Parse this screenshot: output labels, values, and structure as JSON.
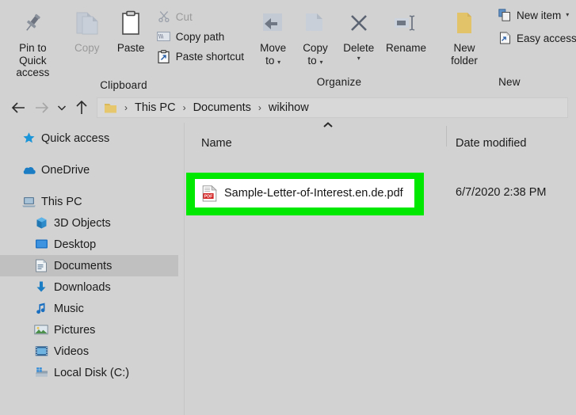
{
  "ribbon": {
    "groups": [
      {
        "name": "Clipboard",
        "label": "Clipboard",
        "big_buttons": [
          {
            "label_line1": "Pin to Quick",
            "label_line2": "access",
            "icon": "pushpin-icon",
            "enabled": true
          },
          {
            "label_line1": "Copy",
            "label_line2": "",
            "icon": "copy-icon",
            "enabled": false
          },
          {
            "label_line1": "Paste",
            "label_line2": "",
            "icon": "clipboard-icon",
            "enabled": true
          }
        ],
        "small_buttons": [
          {
            "label": "Cut",
            "icon": "scissors-icon",
            "enabled": false
          },
          {
            "label": "Copy path",
            "icon": "copy-path-icon",
            "enabled": true
          },
          {
            "label": "Paste shortcut",
            "icon": "paste-shortcut-icon",
            "enabled": true
          }
        ]
      },
      {
        "name": "Organize",
        "label": "Organize",
        "big_buttons": [
          {
            "label_line1": "Move",
            "label_line2": "to",
            "icon": "move-to-icon",
            "enabled": true,
            "has_caret": true
          },
          {
            "label_line1": "Copy",
            "label_line2": "to",
            "icon": "copy-to-icon",
            "enabled": true,
            "has_caret": true
          },
          {
            "label_line1": "Delete",
            "label_line2": "",
            "icon": "delete-x-icon",
            "enabled": true,
            "caret_below": true
          },
          {
            "label_line1": "Rename",
            "label_line2": "",
            "icon": "rename-icon",
            "enabled": true
          }
        ]
      },
      {
        "name": "New",
        "label": "New",
        "big_buttons": [
          {
            "label_line1": "New",
            "label_line2": "folder",
            "icon": "new-folder-icon",
            "enabled": true
          }
        ],
        "small_buttons": [
          {
            "label": "New item",
            "icon": "new-item-icon",
            "enabled": true,
            "has_caret": true
          },
          {
            "label": "Easy access",
            "icon": "easy-access-icon",
            "enabled": true,
            "has_caret": true
          }
        ]
      }
    ]
  },
  "addressbar": {
    "back_icon": "back-arrow-icon",
    "forward_icon": "forward-arrow-icon",
    "recent_icon": "chevron-down-icon",
    "up_icon": "up-arrow-icon",
    "folder_icon": "folder-icon",
    "breadcrumbs": [
      "This PC",
      "Documents",
      "wikihow"
    ],
    "separator": "›"
  },
  "sidebar": {
    "items": [
      {
        "label": "Quick access",
        "icon": "star-pin-icon",
        "indent": 1,
        "selected": false
      },
      {
        "label": "OneDrive",
        "icon": "onedrive-cloud-icon",
        "indent": 1,
        "selected": false
      },
      {
        "label": "This PC",
        "icon": "this-pc-icon",
        "indent": 1,
        "selected": false
      },
      {
        "label": "3D Objects",
        "icon": "3d-objects-icon",
        "indent": 2,
        "selected": false
      },
      {
        "label": "Desktop",
        "icon": "desktop-icon",
        "indent": 2,
        "selected": false
      },
      {
        "label": "Documents",
        "icon": "documents-icon",
        "indent": 2,
        "selected": true
      },
      {
        "label": "Downloads",
        "icon": "downloads-icon",
        "indent": 2,
        "selected": false
      },
      {
        "label": "Music",
        "icon": "music-icon",
        "indent": 2,
        "selected": false
      },
      {
        "label": "Pictures",
        "icon": "pictures-icon",
        "indent": 2,
        "selected": false
      },
      {
        "label": "Videos",
        "icon": "videos-icon",
        "indent": 2,
        "selected": false
      },
      {
        "label": "Local Disk (C:)",
        "icon": "local-disk-icon",
        "indent": 2,
        "selected": false
      }
    ]
  },
  "filelist": {
    "columns": {
      "name": "Name",
      "date_modified": "Date modified"
    },
    "sort_indicator": "ascending",
    "rows": [
      {
        "name": "Sample-Letter-of-Interest.en.de.pdf",
        "date_modified": "6/7/2020 2:38 PM",
        "icon": "pdf-file-icon",
        "selected": true,
        "highlighted": true
      }
    ]
  },
  "colors": {
    "highlight_green": "#00e800",
    "window_background": "#d2d2d2",
    "selected_row_background": "#c0c0c0",
    "file_row_background": "#ffffff",
    "pdf_red": "#d32222",
    "folder_yellow": "#e8c468"
  }
}
